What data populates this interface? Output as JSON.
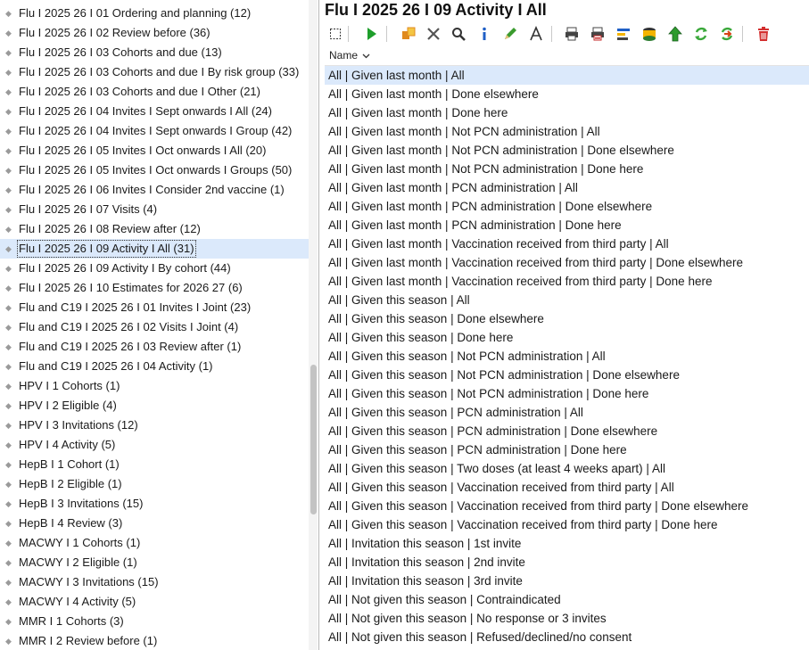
{
  "tree": {
    "selected_index": 12,
    "items": [
      "Flu I 2025 26 I 01 Ordering and planning (12)",
      "Flu I 2025 26 I 02 Review before (36)",
      "Flu I 2025 26 I 03 Cohorts and due (13)",
      "Flu I 2025 26 I 03 Cohorts and due I By risk group (33)",
      "Flu I 2025 26 I 03 Cohorts and due I Other (21)",
      "Flu I 2025 26 I 04 Invites I Sept onwards I All (24)",
      "Flu I 2025 26 I 04 Invites I Sept onwards I Group (42)",
      "Flu I 2025 26 I 05 Invites I Oct onwards I All (20)",
      "Flu I 2025 26 I 05 Invites I Oct onwards I Groups (50)",
      "Flu I 2025 26 I 06 Invites I Consider 2nd vaccine (1)",
      "Flu I 2025 26 I 07 Visits (4)",
      "Flu I 2025 26 I 08 Review after (12)",
      "Flu I 2025 26 I 09 Activity I All (31)",
      "Flu I 2025 26 I 09 Activity I By cohort (44)",
      "Flu I 2025 26 I 10 Estimates for 2026 27 (6)",
      "Flu and C19 I 2025 26 I 01 Invites I Joint (23)",
      "Flu and C19 I 2025 26 I 02 Visits I Joint (4)",
      "Flu and C19 I 2025 26 I 03 Review after (1)",
      "Flu and C19 I 2025 26 I 04 Activity (1)",
      "HPV I 1 Cohorts (1)",
      "HPV I 2 Eligible (4)",
      "HPV I 3 Invitations (12)",
      "HPV I 4 Activity (5)",
      "HepB I 1 Cohort (1)",
      "HepB I 2 Eligible (1)",
      "HepB I 3 Invitations (15)",
      "HepB I 4 Review (3)",
      "MACWY I 1 Cohorts (1)",
      "MACWY I 2 Eligible (1)",
      "MACWY I 3 Invitations (15)",
      "MACWY I 4 Activity (5)",
      "MMR I 1 Cohorts (3)",
      "MMR I 2 Review before (1)"
    ]
  },
  "folder": {
    "title": "Flu I 2025 26 I 09 Activity I All"
  },
  "toolbar": {
    "buttons": [
      {
        "icon": "select-box-icon",
        "color": "#333333"
      },
      {
        "icon": "run-play-icon",
        "color": "#1e9e2b"
      },
      {
        "icon": "move-copy-icon",
        "color": "#e08a1e"
      },
      {
        "icon": "delete-x-icon",
        "color": "#555555"
      },
      {
        "icon": "search-icon",
        "color": "#333333"
      },
      {
        "icon": "info-icon",
        "color": "#1f5fc6"
      },
      {
        "icon": "edit-pen-icon",
        "color": "#3a9b2e"
      },
      {
        "icon": "font-text-icon",
        "color": "#333333"
      },
      {
        "icon": "print-icon",
        "color": "#444444"
      },
      {
        "icon": "print-red-icon",
        "color": "#c62828"
      },
      {
        "icon": "chart-report-icon",
        "color": "#1f5fc6"
      },
      {
        "icon": "database-icon",
        "color": "#2e7d32"
      },
      {
        "icon": "upload-arrow-icon",
        "color": "#2e9b2e"
      },
      {
        "icon": "refresh-icon",
        "color": "#3aa83a"
      },
      {
        "icon": "refresh-arrow-icon",
        "color": "#d84315"
      },
      {
        "icon": "trash-icon",
        "color": "#d32f2f"
      }
    ]
  },
  "list": {
    "column_name": "Name",
    "sort_icon": "chevron-down-icon",
    "selected_index": 0,
    "rows": [
      "All | Given last month | All",
      "All | Given last month | Done elsewhere",
      "All | Given last month | Done here",
      "All | Given last month | Not PCN administration | All",
      "All | Given last month | Not PCN administration | Done elsewhere",
      "All | Given last month | Not PCN administration | Done here",
      "All | Given last month | PCN administration | All",
      "All | Given last month | PCN administration | Done elsewhere",
      "All | Given last month | PCN administration | Done here",
      "All | Given last month | Vaccination received from third party | All",
      "All | Given last month | Vaccination received from third party | Done elsewhere",
      "All | Given last month | Vaccination received from third party | Done here",
      "All | Given this season | All",
      "All | Given this season | Done elsewhere",
      "All | Given this season | Done here",
      "All | Given this season | Not PCN administration | All",
      "All | Given this season | Not PCN administration | Done elsewhere",
      "All | Given this season | Not PCN administration | Done here",
      "All | Given this season | PCN administration | All",
      "All | Given this season | PCN administration | Done elsewhere",
      "All | Given this season | PCN administration | Done here",
      "All | Given this season | Two doses (at least 4 weeks apart) | All",
      "All | Given this season | Vaccination received from third party | All",
      "All | Given this season | Vaccination received from third party | Done elsewhere",
      "All | Given this season | Vaccination received from third party | Done here",
      "All | Invitation this season | 1st invite",
      "All | Invitation this season | 2nd invite",
      "All | Invitation this season | 3rd invite",
      "All | Not given this season | Contraindicated",
      "All | Not given this season | No response or 3 invites",
      "All | Not given this season | Refused/declined/no consent"
    ]
  }
}
